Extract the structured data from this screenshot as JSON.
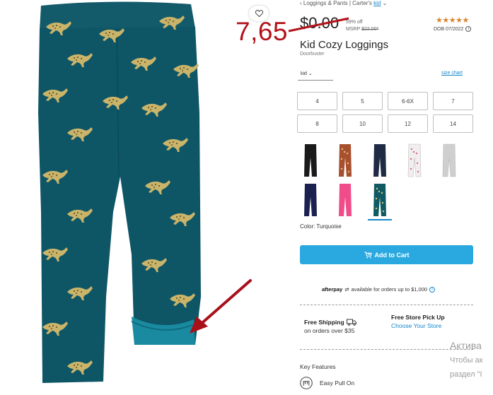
{
  "breadcrumb": {
    "category": "Loggings & Pants",
    "separator": "|",
    "brand": "Carter's",
    "gender": "kid"
  },
  "price": {
    "old": "$0.00",
    "off": "59% off",
    "msrp_label": "MSRP",
    "msrp_value": "$22.00*"
  },
  "rating": {
    "stars": "★★★★★",
    "value": 5,
    "dob": "DOB 07/2022"
  },
  "product": {
    "title": "Kid Cozy Loggings",
    "subtitle": "Doorbuster"
  },
  "size": {
    "selected": "kid",
    "chart_link": "size chart",
    "options": [
      "4",
      "5",
      "6-6X",
      "7",
      "8",
      "10",
      "12",
      "14"
    ]
  },
  "swatches": [
    {
      "name": "black",
      "color": "#1a1a1a",
      "pattern": "solid"
    },
    {
      "name": "brown-print",
      "color": "#a8502e",
      "pattern": "print"
    },
    {
      "name": "navy",
      "color": "#1f2a44",
      "pattern": "solid"
    },
    {
      "name": "white-print",
      "color": "#f2eeee",
      "pattern": "print"
    },
    {
      "name": "gray",
      "color": "#cfcfcf",
      "pattern": "solid"
    },
    {
      "name": "navy-dark",
      "color": "#1a2150",
      "pattern": "solid"
    },
    {
      "name": "pink",
      "color": "#f04c8a",
      "pattern": "solid"
    },
    {
      "name": "turquoise-print",
      "color": "#0f5a63",
      "pattern": "print"
    }
  ],
  "color_label": "Color: Turquoise",
  "cart": {
    "label": "Add to Cart",
    "icon": "cart-icon",
    "color": "#2aa9e0"
  },
  "afterpay": {
    "brand": "afterpay",
    "text": "available for orders up to $1,000"
  },
  "shipping": {
    "title": "Free Shipping",
    "subtitle": "on orders over $35"
  },
  "pickup": {
    "title": "Free Store Pick Up",
    "subtitle": "Choose Your Store"
  },
  "features": {
    "title": "Key Features",
    "item1": "Easy Pull On"
  },
  "annotation": {
    "new_price": "7,65",
    "color": "#b3121a"
  },
  "windows_watermark": {
    "title": "Актива",
    "line1": "Чтобы ак",
    "line2": "раздел \"I"
  }
}
